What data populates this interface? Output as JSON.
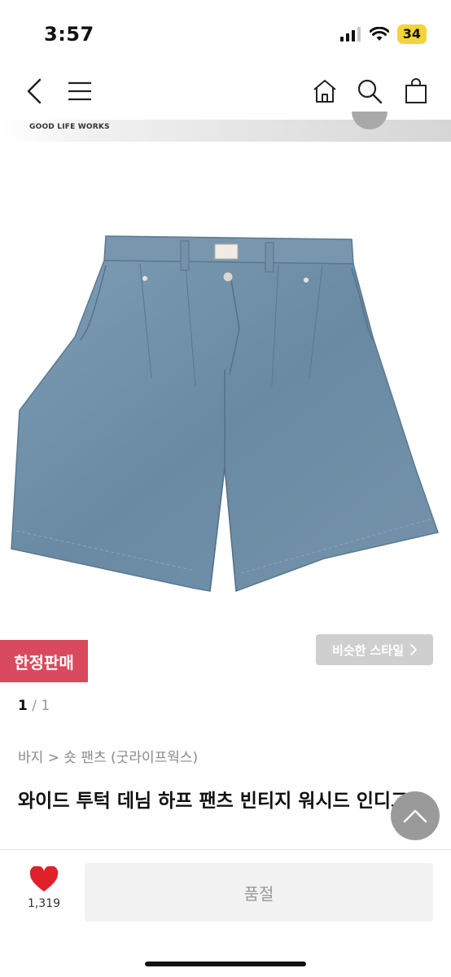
{
  "status": {
    "time": "3:57",
    "battery": "34"
  },
  "brand_strip": {
    "text": "GOOD LIFE WORKS"
  },
  "badges": {
    "limited": "한정판매",
    "similar": "비슷한 스타일"
  },
  "pager": {
    "current": "1",
    "separator": " / ",
    "total": "1"
  },
  "breadcrumb": "바지 > 숏 팬츠 (굿라이프웍스)",
  "product": {
    "title": "와이드 투턱 데님 하프 팬츠 빈티지 워시드 인디고"
  },
  "like": {
    "count": "1,319"
  },
  "cta": {
    "label": "품절"
  },
  "colors": {
    "accent": "#d94a5e",
    "heart": "#e0202a",
    "denim": "#6f8fa6"
  }
}
